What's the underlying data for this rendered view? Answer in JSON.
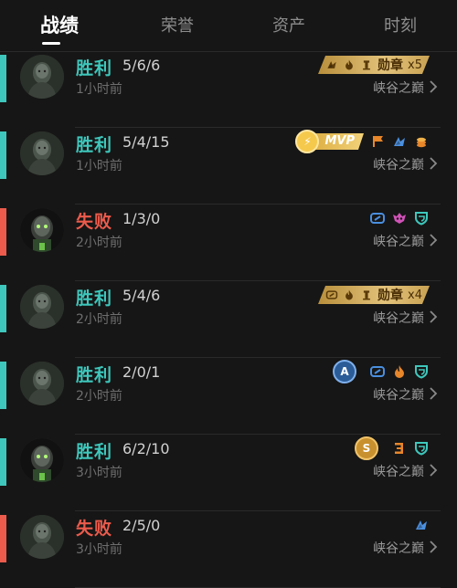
{
  "tabs": [
    {
      "label": "战绩",
      "active": true
    },
    {
      "label": "荣誉",
      "active": false
    },
    {
      "label": "资产",
      "active": false
    },
    {
      "label": "时刻",
      "active": false
    }
  ],
  "colors": {
    "win": "#3ec7bc",
    "loss": "#ec5b4c",
    "gold": "#d7b565",
    "orange": "#e8862a",
    "blue": "#4a8fe0",
    "pink": "#d053b8"
  },
  "matches": [
    {
      "result": "胜利",
      "kda": "5/6/6",
      "time": "1小时前",
      "mode": "峡谷之巅",
      "avatar": "hero-avatar-1",
      "badges": {
        "honor": {
          "label": "勋章",
          "count": "x5",
          "icons": [
            "kill-icon",
            "flame-icon",
            "tower-icon"
          ]
        }
      }
    },
    {
      "result": "胜利",
      "kda": "5/4/15",
      "time": "1小时前",
      "mode": "峡谷之巅",
      "avatar": "hero-avatar-1",
      "badges": {
        "mvp": "MVP",
        "icons": [
          "flag-icon",
          "kill-icon",
          "coins-icon"
        ]
      }
    },
    {
      "result": "失败",
      "kda": "1/3/0",
      "time": "2小时前",
      "mode": "峡谷之巅",
      "avatar": "hero-avatar-2",
      "badges": {
        "icons": [
          "link-icon",
          "mask-icon",
          "shield-icon"
        ]
      }
    },
    {
      "result": "胜利",
      "kda": "5/4/6",
      "time": "2小时前",
      "mode": "峡谷之巅",
      "avatar": "hero-avatar-1",
      "badges": {
        "honor": {
          "label": "勋章",
          "count": "x4",
          "icons": [
            "link-icon",
            "flame-icon",
            "tower-icon"
          ]
        }
      }
    },
    {
      "result": "胜利",
      "kda": "2/0/1",
      "time": "2小时前",
      "mode": "峡谷之巅",
      "avatar": "hero-avatar-1",
      "badges": {
        "coin": "A",
        "icons": [
          "link-icon",
          "flame-icon",
          "shield-icon"
        ]
      }
    },
    {
      "result": "胜利",
      "kda": "6/2/10",
      "time": "3小时前",
      "mode": "峡谷之巅",
      "avatar": "hero-avatar-2",
      "badges": {
        "coin": "S",
        "icons": [
          "three-icon",
          "shield-icon"
        ]
      }
    },
    {
      "result": "失败",
      "kda": "2/5/0",
      "time": "3小时前",
      "mode": "峡谷之巅",
      "avatar": "hero-avatar-1",
      "badges": {
        "icons": [
          "kill-icon"
        ]
      }
    }
  ]
}
